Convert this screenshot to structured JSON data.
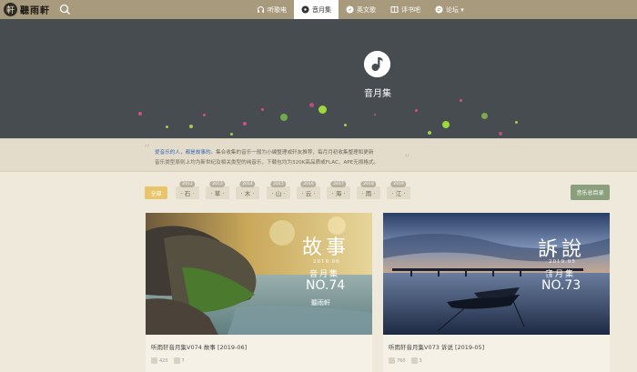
{
  "brand": {
    "name": "聽雨軒"
  },
  "nav": {
    "items": [
      {
        "label": "听歌电",
        "icon": "headphones-icon",
        "active": false
      },
      {
        "label": "音月集",
        "icon": "disc-icon",
        "active": true
      },
      {
        "label": "英文歌",
        "icon": "compass-icon",
        "active": false
      },
      {
        "label": "评书吧",
        "icon": "book-icon",
        "active": false
      },
      {
        "label": "论坛 ▾",
        "icon": "chat-icon",
        "active": false
      }
    ]
  },
  "hero": {
    "title": "音月集"
  },
  "quote": {
    "highlight": "爱音乐的人，都是故事的。",
    "line1": "集合收集的音乐一般为小编整理或轩友推荐，每月月初收集整理和更新",
    "line2": "音乐类型原则上均为新世纪及相关类型的纯音乐，下载包均为320K高品质或FLAC、APE无损格式。"
  },
  "filters": {
    "all": "全部",
    "tags": [
      {
        "year": "2012",
        "label": "· 石 ·"
      },
      {
        "year": "2013",
        "label": "· 草 ·"
      },
      {
        "year": "2014",
        "label": "· 木 ·"
      },
      {
        "year": "2015",
        "label": "· 山 ·"
      },
      {
        "year": "2016",
        "label": "· 云 ·"
      },
      {
        "year": "2017",
        "label": "· 海 ·"
      },
      {
        "year": "2018",
        "label": "· 雨 ·"
      },
      {
        "year": "2019",
        "label": "· 江 ·"
      }
    ],
    "directory": "音乐总目录"
  },
  "cards": [
    {
      "title": "听雨轩音月集V074 故事 [2019-06]",
      "cover_title": "故事",
      "cover_date": "2019.06",
      "cover_sub": "音月集",
      "cover_no": "NO.74",
      "cover_brand": "聽雨軒",
      "views": "420",
      "comments": "7"
    },
    {
      "title": "听雨轩音月集V073 诉说 [2019-05]",
      "cover_title": "訴說",
      "cover_date": "2019.05",
      "cover_sub": "音月集",
      "cover_no": "NO.73",
      "views": "760",
      "comments": "3"
    }
  ],
  "colors": {
    "nav": "#a89a7c",
    "hero": "#474c51",
    "accent_yellow": "#e8c46a",
    "accent_green": "#8aa07c",
    "link": "#3a67b5"
  }
}
